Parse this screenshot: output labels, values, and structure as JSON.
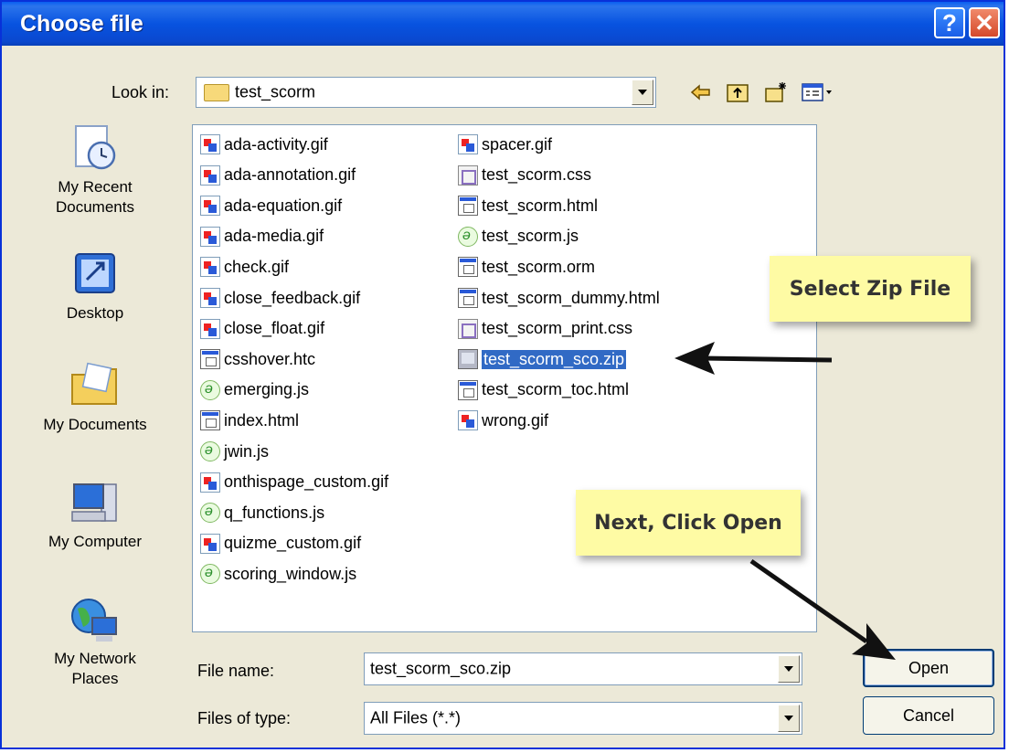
{
  "dialog": {
    "title": "Choose file",
    "help_label": "?",
    "close_label": "✕"
  },
  "look_in": {
    "label": "Look in:",
    "value": "test_scorm"
  },
  "toolbar": {
    "icons": [
      "back-icon",
      "up-folder-icon",
      "new-folder-icon",
      "view-menu-icon"
    ]
  },
  "places": [
    {
      "label_line1": "My Recent",
      "label_line2": "Documents",
      "icon": "recent-documents-icon"
    },
    {
      "label_line1": "Desktop",
      "label_line2": "",
      "icon": "desktop-icon"
    },
    {
      "label_line1": "My Documents",
      "label_line2": "",
      "icon": "my-documents-icon"
    },
    {
      "label_line1": "My Computer",
      "label_line2": "",
      "icon": "my-computer-icon"
    },
    {
      "label_line1": "My Network",
      "label_line2": "Places",
      "icon": "network-places-icon"
    }
  ],
  "files": {
    "column1": [
      {
        "name": "ada-activity.gif",
        "type": "gif"
      },
      {
        "name": "ada-annotation.gif",
        "type": "gif"
      },
      {
        "name": "ada-equation.gif",
        "type": "gif"
      },
      {
        "name": "ada-media.gif",
        "type": "gif"
      },
      {
        "name": "check.gif",
        "type": "gif"
      },
      {
        "name": "close_feedback.gif",
        "type": "gif"
      },
      {
        "name": "close_float.gif",
        "type": "gif"
      },
      {
        "name": "csshover.htc",
        "type": "html"
      },
      {
        "name": "emerging.js",
        "type": "js"
      },
      {
        "name": "index.html",
        "type": "html"
      },
      {
        "name": "jwin.js",
        "type": "js"
      },
      {
        "name": "onthispage_custom.gif",
        "type": "gif"
      },
      {
        "name": "q_functions.js",
        "type": "js"
      },
      {
        "name": "quizme_custom.gif",
        "type": "gif"
      },
      {
        "name": "scoring_window.js",
        "type": "js"
      }
    ],
    "column2": [
      {
        "name": "spacer.gif",
        "type": "gif"
      },
      {
        "name": "test_scorm.css",
        "type": "css"
      },
      {
        "name": "test_scorm.html",
        "type": "html"
      },
      {
        "name": "test_scorm.js",
        "type": "js"
      },
      {
        "name": "test_scorm.orm",
        "type": "html"
      },
      {
        "name": "test_scorm_dummy.html",
        "type": "html"
      },
      {
        "name": "test_scorm_print.css",
        "type": "css"
      },
      {
        "name": "test_scorm_sco.zip",
        "type": "zip",
        "selected": true
      },
      {
        "name": "test_scorm_toc.html",
        "type": "html"
      },
      {
        "name": "wrong.gif",
        "type": "gif"
      }
    ]
  },
  "file_name": {
    "label": "File name:",
    "value": "test_scorm_sco.zip"
  },
  "file_type": {
    "label": "Files of type:",
    "value": "All Files (*.*)"
  },
  "buttons": {
    "open": "Open",
    "cancel": "Cancel"
  },
  "annotations": {
    "select_zip": "Select Zip File",
    "click_open": "Next, Click Open"
  }
}
